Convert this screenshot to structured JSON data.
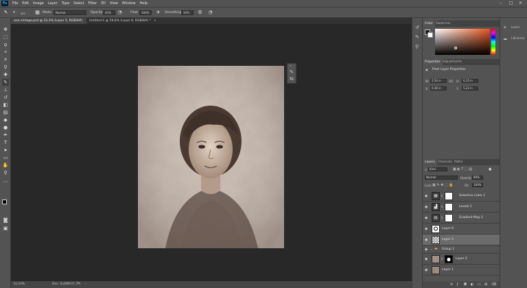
{
  "menu": {
    "logo": "Ps",
    "items": [
      "File",
      "Edit",
      "Image",
      "Layer",
      "Type",
      "Select",
      "Filter",
      "3D",
      "View",
      "Window",
      "Help"
    ]
  },
  "options": {
    "brush_size": "300",
    "mode_label": "Mode:",
    "mode_value": "Normal",
    "opacity_label": "Opacity:",
    "opacity_value": "42%",
    "flow_label": "Flow:",
    "flow_value": "100%",
    "smoothing_label": "Smoothing:",
    "smoothing_value": "10%"
  },
  "tabs": [
    {
      "label": "ana vintage.psd @ 33,3% (Layer 5, RGB/8#) *",
      "close": "×"
    },
    {
      "label": "Untitled-1 @ 59,6% (Layer 6, RGB/8#) *",
      "close": "×"
    }
  ],
  "status": {
    "zoom": "33,33%",
    "doc": "Doc: 6,46M/37,7M"
  },
  "color_panel": {
    "tab_color": "Color",
    "tab_swatches": "Swatches"
  },
  "properties": {
    "tab_properties": "Properties",
    "tab_adjustments": "Adjustments",
    "title": "Pixel Layer Properties",
    "w_label": "W:",
    "w_value": "5,54 in",
    "go_label": "GO",
    "h_label": "H:",
    "h_value": "6,15 in",
    "x_label": "X:",
    "x_value": "0,38 in",
    "y_label": "Y:",
    "y_value": "5,22 in"
  },
  "layers_panel": {
    "tab_layers": "Layers",
    "tab_channels": "Channels",
    "tab_paths": "Paths",
    "kind_value": "Kind",
    "blend_value": "Normal",
    "opacity_label": "Opacity:",
    "opacity_value": "89%",
    "lock_label": "Lock:",
    "fill_label": "Fill:",
    "fill_value": "100%",
    "layers": [
      {
        "name": "Selective Color 1",
        "type": "adjustment",
        "icon": "sliders-icon"
      },
      {
        "name": "Levels 1",
        "type": "adjustment",
        "icon": "levels-icon"
      },
      {
        "name": "Gradient Map 1",
        "type": "adjustment",
        "icon": "gradient-icon"
      },
      {
        "name": "Layer 6",
        "type": "pixel"
      },
      {
        "name": "Layer 5",
        "type": "pixel",
        "selected": true
      },
      {
        "name": "Group 1",
        "type": "group"
      },
      {
        "name": "Layer 2",
        "type": "masked"
      },
      {
        "name": "Layer 1",
        "type": "pixel"
      }
    ]
  },
  "right_strip": {
    "learn": "Learn",
    "libraries": "Libraries"
  },
  "colors": {
    "chrome": "#535353",
    "canvas_bg": "#282828",
    "picker_hue": "#e8561f"
  }
}
